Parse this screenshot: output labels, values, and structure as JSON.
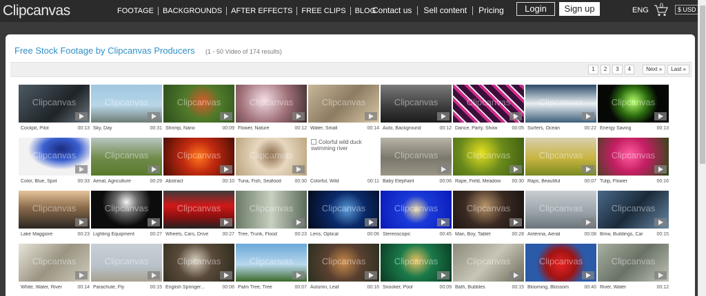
{
  "header": {
    "logo": "Clipcanvas",
    "nav": [
      "FOOTAGE",
      "BACKGROUNDS",
      "AFTER EFFECTS",
      "FREE CLIPS",
      "BLOG"
    ],
    "nav2": [
      "Contact us",
      "Sell content",
      "Pricing"
    ],
    "login": "Login",
    "signup": "Sign up",
    "lang": "ENG",
    "cart_count": "0",
    "currency": "$ USD"
  },
  "page": {
    "title": "Free Stock Footage by Clipcanvas Producers",
    "results": "(1 - 50  Video of 174 results)"
  },
  "pager": [
    "1",
    "2",
    "3",
    "4",
    "Next »",
    "Last »"
  ],
  "watermark": "Clipcanvas",
  "clips": [
    {
      "label": "Cockpit, Pilot",
      "dur": "00:13",
      "bg": "linear-gradient(135deg,#4d5a63,#1e2428 60%,#6c7880)"
    },
    {
      "label": "Sky, Day",
      "dur": "00:31",
      "bg": "linear-gradient(180deg,#9ec6df,#b8d6e8 55%,#6d7c74)"
    },
    {
      "label": "Shrimp, Nano",
      "dur": "00:09",
      "bg": "radial-gradient(circle at 55% 45%,#d85a2a,#4f7a2a 40%,#2d4d1b)"
    },
    {
      "label": "Flower, Nature",
      "dur": "00:12",
      "bg": "radial-gradient(circle at 40% 40%,#f3dce4,#9f6f77 50%,#3c2d2d)"
    },
    {
      "label": "Water, Small",
      "dur": "00:14",
      "bg": "linear-gradient(135deg,#c8b79a,#8d7b62 50%,#d9c9a7)"
    },
    {
      "label": "Auto, Background",
      "dur": "00:12",
      "bg": "linear-gradient(180deg,#7b7b7b,#3b3b3b 60%,#1c1c1c)"
    },
    {
      "label": "Dance, Party, Show",
      "dur": "00:05",
      "bg": "repeating-linear-gradient(45deg,#3a0f3a 0 8px,#d02a8a 8px 12px,#e8e8e8 12px 14px)"
    },
    {
      "label": "Surfers, Ocean",
      "dur": "00:22",
      "bg": "linear-gradient(180deg,#2a4a66,#e8eef2 50%,#3d5f7a)"
    },
    {
      "label": "Energy Saving",
      "dur": "00:13",
      "bg": "radial-gradient(circle at 50% 45%,#b4ff6a,#2d6d10 35%,#050805 60%)"
    },
    {
      "label": "Color, Blue, Spot",
      "dur": "00:33",
      "bg": "radial-gradient(ellipse at 60% 30%,#1c2b7d,#3a5fd0 30%,#f2f2f2 55%)"
    },
    {
      "label": "Aerial, Agriculture",
      "dur": "00:29",
      "bg": "linear-gradient(180deg,#b8c6c2,#6f8a4a 55%,#5a7a2a)"
    },
    {
      "label": "Abstract",
      "dur": "00:10",
      "bg": "radial-gradient(circle at 50% 50%,#ff7a1a,#c22a10 40%,#4a0d05)"
    },
    {
      "label": "Tuna, Fish, Seafood",
      "dur": "00:30",
      "bg": "radial-gradient(circle at 50% 45%,#8a6a4a,#e8d8c0 40%,#b8a27a)"
    },
    {
      "label": "Colorful, Wild",
      "dur": "00:11",
      "broken": "Colorful wild duck swimming river"
    },
    {
      "label": "Baby Elephant",
      "dur": "00:06",
      "bg": "linear-gradient(180deg,#b8b4a6,#7a776c 55%,#9c9686)"
    },
    {
      "label": "Rape, Field, Meadow",
      "dur": "00:30",
      "bg": "radial-gradient(circle at 40% 40%,#e6e020,#6a8a1c 45%,#3c5a10)"
    },
    {
      "label": "Raps, Beautiful",
      "dur": "00:07",
      "bg": "linear-gradient(180deg,#d8cfb0,#c8b440 55%,#7a8a20)"
    },
    {
      "label": "Tulip, Flower",
      "dur": "00:16",
      "bg": "radial-gradient(circle at 45% 45%,#ff5fa0,#c41e63 40%,#2a4a14)"
    },
    {
      "label": "Lake Maggiore",
      "dur": "00:23",
      "bg": "linear-gradient(180deg,#e6c49a,#8a6a4a 45%,#2a2622)"
    },
    {
      "label": "Lighting Equipment",
      "dur": "00:27",
      "bg": "radial-gradient(circle at 50% 30%,#f4f4f4,#6a6a6a 25%,#0c0c0c 55%)"
    },
    {
      "label": "Wheels, Cars, Drive",
      "dur": "00:27",
      "bg": "linear-gradient(180deg,#3a3a3a,#d21818 40%,#8a1010 70%,#222)"
    },
    {
      "label": "Tree, Trunk, Flood",
      "dur": "00:23",
      "bg": "linear-gradient(90deg,#6a7a66,#c8d0c0 50%,#5a6a5a)"
    },
    {
      "label": "Lens, Optical",
      "dur": "00:06",
      "bg": "radial-gradient(circle at 55% 50%,#5a9ad8,#0a2a6a 40%,#050a1a)"
    },
    {
      "label": "Stereoscopic",
      "dur": "00:45",
      "bg": "radial-gradient(circle at 50% 50%,#e8d8a0,#1a3ad8 35%,#0a1ab8)"
    },
    {
      "label": "Man, Boy, Tablet",
      "dur": "00:28",
      "bg": "radial-gradient(circle at 45% 40%,#b8946a,#3a2a22 45%,#151010)"
    },
    {
      "label": "Antenna, Aerial",
      "dur": "00:08",
      "bg": "linear-gradient(180deg,#c8ced2,#9aa4aa 55%,#6a767c)"
    },
    {
      "label": "Bmw, Buildings, Car",
      "dur": "00:15",
      "bg": "linear-gradient(135deg,#4a6a8a,#1a2a3a 50%,#6a8aa8)"
    },
    {
      "label": "White, Water, River",
      "dur": "00:14",
      "bg": "linear-gradient(135deg,#e8e4d8,#9a9482 50%,#d0ccbc)"
    },
    {
      "label": "Parachute, Fly",
      "dur": "00:15",
      "bg": "linear-gradient(180deg,#c8d0d6,#b8c2c8 60%,#a8a090)"
    },
    {
      "label": "English Springer...",
      "dur": "00:06",
      "bg": "radial-gradient(circle at 45% 45%,#d8d0c0,#5a4a3a 40%,#2a2a1a)"
    },
    {
      "label": "Palm Tree, Tree",
      "dur": "00:07",
      "bg": "linear-gradient(180deg,#6aa8d8,#b8d8ec 55%,#3a6a2a)"
    },
    {
      "label": "Autumn, Leaf",
      "dur": "00:16",
      "bg": "radial-gradient(circle at 50% 50%,#c88a4a,#5a4030 45%,#2a3020)"
    },
    {
      "label": "Snooker, Pool",
      "dur": "00:09",
      "bg": "radial-gradient(circle at 50% 45%,#e8c060,#1a7a4a 40%,#0a3a22)"
    },
    {
      "label": "Bath, Bubbles",
      "dur": "00:15",
      "bg": "linear-gradient(135deg,#8a8a7a,#c8c6b6 50%,#6a6a5a)"
    },
    {
      "label": "Blooming, Blossom",
      "dur": "00:40",
      "bg": "radial-gradient(circle at 50% 55%,#e82222,#a01414 35%,#2a5aa8 60%)"
    },
    {
      "label": "River, Water",
      "dur": "00:12",
      "bg": "linear-gradient(135deg,#a8b0a0,#6a7266 50%,#c0c6b8)"
    }
  ]
}
